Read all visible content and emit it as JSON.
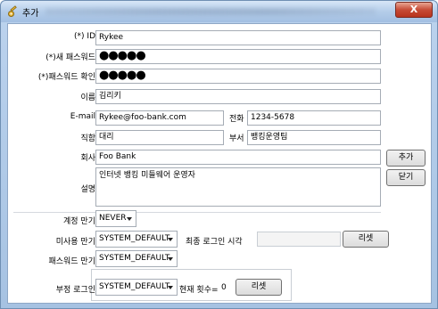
{
  "window": {
    "title": "추가",
    "close_symbol": "X"
  },
  "form": {
    "id": {
      "label": "(*) ID",
      "value": "Rykee"
    },
    "new_password": {
      "label": "(*)새 패스워드",
      "value": "●●●●●"
    },
    "confirm_password": {
      "label": "(*)패스워드 확인",
      "value": "●●●●●"
    },
    "name": {
      "label": "이름",
      "value": "김리키"
    },
    "email": {
      "label": "E-mail",
      "value": "Rykee@foo-bank.com"
    },
    "phone": {
      "label": "전화",
      "value": "1234-5678"
    },
    "position": {
      "label": "직함",
      "value": "대리"
    },
    "department": {
      "label": "부서",
      "value": "뱅킹운영팀"
    },
    "company": {
      "label": "회사",
      "value": "Foo Bank"
    },
    "description": {
      "label": "설명",
      "value": "인터넷 뱅킹 미들웨어 운영자"
    },
    "account_expiry": {
      "label": "계정 만기",
      "value": "NEVER"
    },
    "unused_expiry": {
      "label": "미사용 만기",
      "value": "SYSTEM_DEFAULT"
    },
    "last_login": {
      "label": "최종 로그인 시각",
      "value": "",
      "reset_label": "리셋"
    },
    "password_expiry": {
      "label": "패스워드 만기",
      "value": "SYSTEM_DEFAULT"
    },
    "invalid_login": {
      "label": "부정 로그인",
      "value": "SYSTEM_DEFAULT",
      "count_label": "현재 횟수=",
      "count_value": "0",
      "reset_label": "리셋"
    }
  },
  "actions": {
    "add_label": "추가",
    "close_label": "닫기"
  }
}
